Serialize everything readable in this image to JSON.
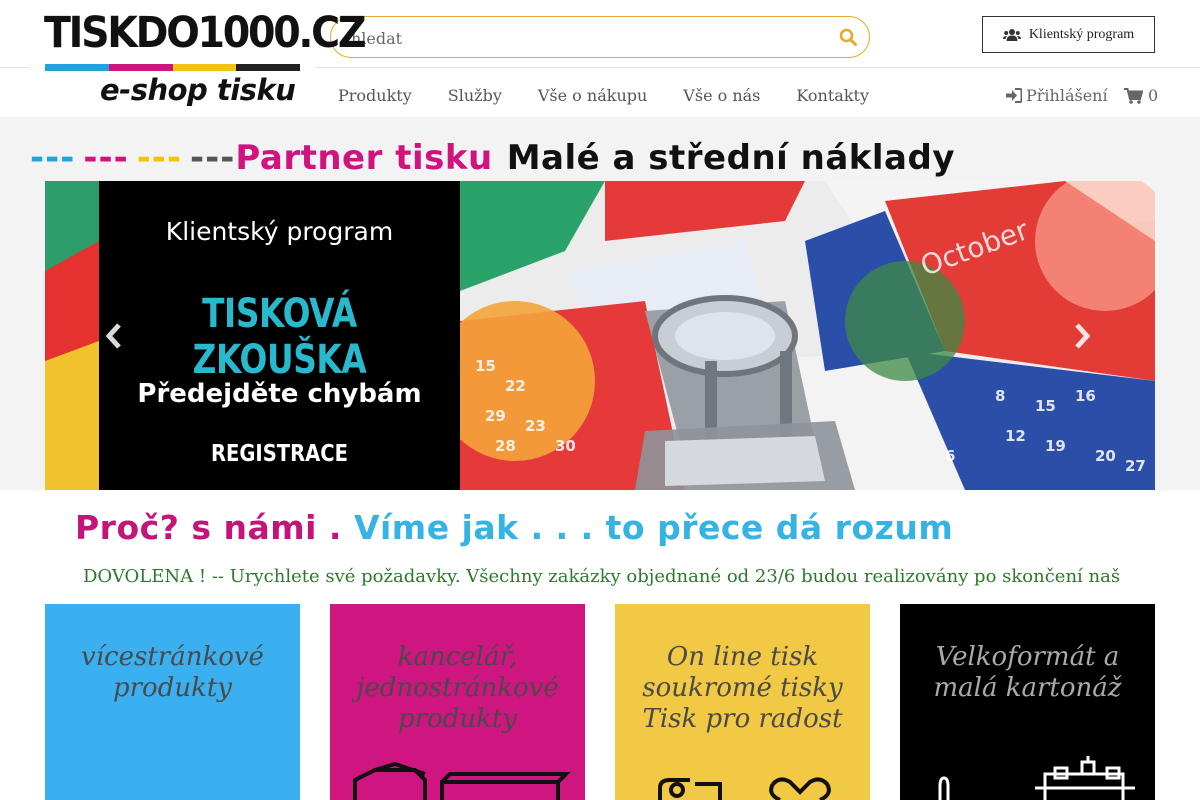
{
  "logo": {
    "main": "TISKDO1000.CZ",
    "sub": "e-shop tisku",
    "bar_colors": [
      "#1fa3dd",
      "#d1137f",
      "#f1c40f",
      "#222222"
    ]
  },
  "search": {
    "placeholder": "hledat",
    "icon": "search-icon"
  },
  "client_button": {
    "label": "Klientský program",
    "icon": "users-icon"
  },
  "nav": {
    "items": [
      {
        "label": "Produkty"
      },
      {
        "label": "Služby"
      },
      {
        "label": "Vše o nákupu"
      },
      {
        "label": "Vše o nás"
      },
      {
        "label": "Kontakty"
      }
    ],
    "login_label": "Přihlášení",
    "cart_count": "0"
  },
  "tagline": {
    "dashes": [
      "---",
      "---",
      "---",
      "---"
    ],
    "dash_colors": [
      "#1fa3dd",
      "#d1137f",
      "#f1c40f",
      "#555555"
    ],
    "partner": "Partner tisku",
    "rest": "Malé a střední náklady",
    "partner_color": "#d1137f",
    "rest_color": "#111111"
  },
  "carousel": {
    "line1": "Klientský program",
    "line2": "TISKOVÁ ZKOUŠKA",
    "line3": "Předejděte chybám",
    "line4": "REGISTRACE",
    "accent": "#28b9ce"
  },
  "why": {
    "part1": "Proč? s námi .",
    "part2": "Víme jak . . . to přece dá rozum",
    "color1": "#c4147a",
    "color2": "#35b4e4"
  },
  "marquee": "DOVOLENA ! -- Urychlete své požadavky. Všechny zakázky objednané od 23/6 budou realizovány po skončení naš",
  "tiles": [
    {
      "lines": [
        "vícestránkové",
        "produkty"
      ],
      "bg": "#3bb0f0",
      "color": "#4a4a4a"
    },
    {
      "lines": [
        "kancelář,",
        "jednostránkové",
        "produkty"
      ],
      "bg": "#cf1580",
      "color": "#4a4a4a"
    },
    {
      "lines": [
        "On line tisk",
        "soukromé tisky",
        "Tisk pro radost"
      ],
      "bg": "#f1c945",
      "color": "#4a4a4a"
    },
    {
      "lines": [
        "Velkoformát a",
        "malá kartonáž"
      ],
      "bg": "#000000",
      "color": "#aaaaaa"
    }
  ]
}
